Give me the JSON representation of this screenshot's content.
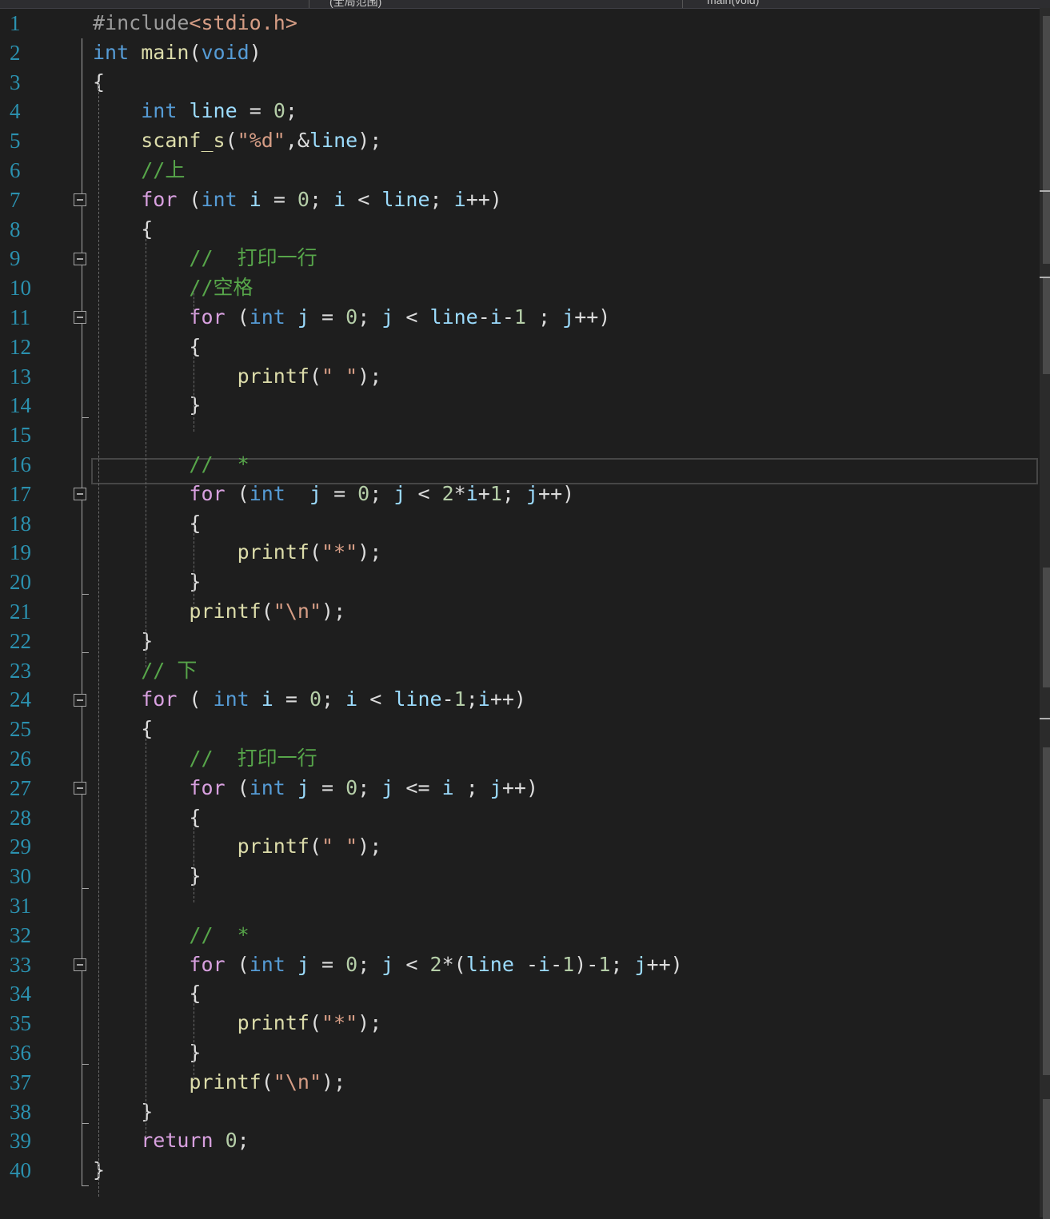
{
  "navbar": {
    "left_scope": "(全局范围)",
    "right_scope": "main(void)"
  },
  "editor": {
    "lines": [
      {
        "n": "1",
        "tokens": [
          [
            "pp",
            "#include"
          ],
          [
            "inc",
            "<stdio.h>"
          ]
        ]
      },
      {
        "n": "2",
        "tokens": [
          [
            "kw",
            "int"
          ],
          [
            "",
            " "
          ],
          [
            "fn",
            "main"
          ],
          [
            "",
            "("
          ],
          [
            "kw",
            "void"
          ],
          [
            "",
            ")"
          ]
        ]
      },
      {
        "n": "3",
        "tokens": [
          [
            "",
            "{"
          ]
        ]
      },
      {
        "n": "4",
        "tokens": [
          [
            "",
            "    "
          ],
          [
            "kw",
            "int"
          ],
          [
            "",
            " "
          ],
          [
            "var",
            "line"
          ],
          [
            "",
            " = "
          ],
          [
            "num",
            "0"
          ],
          [
            "",
            ";"
          ]
        ]
      },
      {
        "n": "5",
        "tokens": [
          [
            "",
            "    "
          ],
          [
            "fn",
            "scanf_s"
          ],
          [
            "",
            "("
          ],
          [
            "str",
            "\"%d\""
          ],
          [
            "",
            ",&"
          ],
          [
            "var",
            "line"
          ],
          [
            "",
            ");"
          ]
        ]
      },
      {
        "n": "6",
        "tokens": [
          [
            "",
            "    "
          ],
          [
            "cmt",
            "//上"
          ]
        ]
      },
      {
        "n": "7",
        "tokens": [
          [
            "",
            "    "
          ],
          [
            "ctl",
            "for"
          ],
          [
            "",
            " ("
          ],
          [
            "kw",
            "int"
          ],
          [
            "",
            " "
          ],
          [
            "var",
            "i"
          ],
          [
            "",
            " = "
          ],
          [
            "num",
            "0"
          ],
          [
            "",
            "; "
          ],
          [
            "var",
            "i"
          ],
          [
            "",
            " < "
          ],
          [
            "var",
            "line"
          ],
          [
            "",
            "; "
          ],
          [
            "var",
            "i"
          ],
          [
            "",
            "++)"
          ]
        ]
      },
      {
        "n": "8",
        "tokens": [
          [
            "",
            "    {"
          ]
        ]
      },
      {
        "n": "9",
        "tokens": [
          [
            "",
            "        "
          ],
          [
            "cmt",
            "//  打印一行"
          ]
        ]
      },
      {
        "n": "10",
        "tokens": [
          [
            "",
            "        "
          ],
          [
            "cmt",
            "//空格"
          ]
        ]
      },
      {
        "n": "11",
        "tokens": [
          [
            "",
            "        "
          ],
          [
            "ctl",
            "for"
          ],
          [
            "",
            " ("
          ],
          [
            "kw",
            "int"
          ],
          [
            "",
            " "
          ],
          [
            "var",
            "j"
          ],
          [
            "",
            " = "
          ],
          [
            "num",
            "0"
          ],
          [
            "",
            "; "
          ],
          [
            "var",
            "j"
          ],
          [
            "",
            " < "
          ],
          [
            "var",
            "line"
          ],
          [
            "",
            "-"
          ],
          [
            "var",
            "i"
          ],
          [
            "",
            "-"
          ],
          [
            "num",
            "1"
          ],
          [
            "",
            " ; "
          ],
          [
            "var",
            "j"
          ],
          [
            "",
            "++)"
          ]
        ]
      },
      {
        "n": "12",
        "tokens": [
          [
            "",
            "        {"
          ]
        ]
      },
      {
        "n": "13",
        "tokens": [
          [
            "",
            "            "
          ],
          [
            "fn",
            "printf"
          ],
          [
            "",
            "("
          ],
          [
            "str",
            "\" \""
          ],
          [
            "",
            ");"
          ]
        ]
      },
      {
        "n": "14",
        "tokens": [
          [
            "",
            "        }"
          ]
        ]
      },
      {
        "n": "15",
        "tokens": []
      },
      {
        "n": "16",
        "tokens": [
          [
            "",
            "        "
          ],
          [
            "cmt",
            "//  *"
          ]
        ]
      },
      {
        "n": "17",
        "tokens": [
          [
            "",
            "        "
          ],
          [
            "ctl",
            "for"
          ],
          [
            "",
            " ("
          ],
          [
            "kw",
            "int"
          ],
          [
            "",
            "  "
          ],
          [
            "var",
            "j"
          ],
          [
            "",
            " = "
          ],
          [
            "num",
            "0"
          ],
          [
            "",
            "; "
          ],
          [
            "var",
            "j"
          ],
          [
            "",
            " < "
          ],
          [
            "num",
            "2"
          ],
          [
            "",
            "*"
          ],
          [
            "var",
            "i"
          ],
          [
            "",
            "+"
          ],
          [
            "num",
            "1"
          ],
          [
            "",
            "; "
          ],
          [
            "var",
            "j"
          ],
          [
            "",
            "++)"
          ]
        ]
      },
      {
        "n": "18",
        "tokens": [
          [
            "",
            "        {"
          ]
        ]
      },
      {
        "n": "19",
        "tokens": [
          [
            "",
            "            "
          ],
          [
            "fn",
            "printf"
          ],
          [
            "",
            "("
          ],
          [
            "str",
            "\"*\""
          ],
          [
            "",
            ");"
          ]
        ]
      },
      {
        "n": "20",
        "tokens": [
          [
            "",
            "        }"
          ]
        ]
      },
      {
        "n": "21",
        "tokens": [
          [
            "",
            "        "
          ],
          [
            "fn",
            "printf"
          ],
          [
            "",
            "("
          ],
          [
            "str",
            "\"\\n\""
          ],
          [
            "",
            ");"
          ]
        ]
      },
      {
        "n": "22",
        "tokens": [
          [
            "",
            "    }"
          ]
        ]
      },
      {
        "n": "23",
        "tokens": [
          [
            "",
            "    "
          ],
          [
            "cmt",
            "// 下"
          ]
        ]
      },
      {
        "n": "24",
        "tokens": [
          [
            "",
            "    "
          ],
          [
            "ctl",
            "for"
          ],
          [
            "",
            " ( "
          ],
          [
            "kw",
            "int"
          ],
          [
            "",
            " "
          ],
          [
            "var",
            "i"
          ],
          [
            "",
            " = "
          ],
          [
            "num",
            "0"
          ],
          [
            "",
            "; "
          ],
          [
            "var",
            "i"
          ],
          [
            "",
            " < "
          ],
          [
            "var",
            "line"
          ],
          [
            "",
            "-"
          ],
          [
            "num",
            "1"
          ],
          [
            "",
            ";"
          ],
          [
            "var",
            "i"
          ],
          [
            "",
            "++)"
          ]
        ]
      },
      {
        "n": "25",
        "tokens": [
          [
            "",
            "    {"
          ]
        ]
      },
      {
        "n": "26",
        "tokens": [
          [
            "",
            "        "
          ],
          [
            "cmt",
            "//  打印一行"
          ]
        ]
      },
      {
        "n": "27",
        "tokens": [
          [
            "",
            "        "
          ],
          [
            "ctl",
            "for"
          ],
          [
            "",
            " ("
          ],
          [
            "kw",
            "int"
          ],
          [
            "",
            " "
          ],
          [
            "var",
            "j"
          ],
          [
            "",
            " = "
          ],
          [
            "num",
            "0"
          ],
          [
            "",
            "; "
          ],
          [
            "var",
            "j"
          ],
          [
            "",
            " <= "
          ],
          [
            "var",
            "i"
          ],
          [
            "",
            " ; "
          ],
          [
            "var",
            "j"
          ],
          [
            "",
            "++)"
          ]
        ]
      },
      {
        "n": "28",
        "tokens": [
          [
            "",
            "        {"
          ]
        ]
      },
      {
        "n": "29",
        "tokens": [
          [
            "",
            "            "
          ],
          [
            "fn",
            "printf"
          ],
          [
            "",
            "("
          ],
          [
            "str",
            "\" \""
          ],
          [
            "",
            ");"
          ]
        ]
      },
      {
        "n": "30",
        "tokens": [
          [
            "",
            "        }"
          ]
        ]
      },
      {
        "n": "31",
        "tokens": []
      },
      {
        "n": "32",
        "tokens": [
          [
            "",
            "        "
          ],
          [
            "cmt",
            "//  *"
          ]
        ]
      },
      {
        "n": "33",
        "tokens": [
          [
            "",
            "        "
          ],
          [
            "ctl",
            "for"
          ],
          [
            "",
            " ("
          ],
          [
            "kw",
            "int"
          ],
          [
            "",
            " "
          ],
          [
            "var",
            "j"
          ],
          [
            "",
            " = "
          ],
          [
            "num",
            "0"
          ],
          [
            "",
            "; "
          ],
          [
            "var",
            "j"
          ],
          [
            "",
            " < "
          ],
          [
            "num",
            "2"
          ],
          [
            "",
            "*("
          ],
          [
            "var",
            "line"
          ],
          [
            "",
            " -"
          ],
          [
            "var",
            "i"
          ],
          [
            "",
            "-"
          ],
          [
            "num",
            "1"
          ],
          [
            "",
            ")-"
          ],
          [
            "num",
            "1"
          ],
          [
            "",
            "; "
          ],
          [
            "var",
            "j"
          ],
          [
            "",
            "++)"
          ]
        ]
      },
      {
        "n": "34",
        "tokens": [
          [
            "",
            "        {"
          ]
        ]
      },
      {
        "n": "35",
        "tokens": [
          [
            "",
            "            "
          ],
          [
            "fn",
            "printf"
          ],
          [
            "",
            "("
          ],
          [
            "str",
            "\"*\""
          ],
          [
            "",
            ");"
          ]
        ]
      },
      {
        "n": "36",
        "tokens": [
          [
            "",
            "        }"
          ]
        ]
      },
      {
        "n": "37",
        "tokens": [
          [
            "",
            "        "
          ],
          [
            "fn",
            "printf"
          ],
          [
            "",
            "("
          ],
          [
            "str",
            "\"\\n\""
          ],
          [
            "",
            ");"
          ]
        ]
      },
      {
        "n": "38",
        "tokens": [
          [
            "",
            "    }"
          ]
        ]
      },
      {
        "n": "39",
        "tokens": [
          [
            "",
            "    "
          ],
          [
            "ctl",
            "return"
          ],
          [
            "",
            " "
          ],
          [
            "num",
            "0"
          ],
          [
            "",
            ";"
          ]
        ]
      },
      {
        "n": "40",
        "tokens": [
          [
            "",
            "}"
          ]
        ]
      }
    ],
    "folds": [
      {
        "start": 7,
        "end": 22
      },
      {
        "start": 9,
        "end": 14
      },
      {
        "start": 11,
        "end": 14
      },
      {
        "start": 17,
        "end": 20
      },
      {
        "start": 24,
        "end": 38
      },
      {
        "start": 27,
        "end": 30
      },
      {
        "start": 33,
        "end": 36
      }
    ],
    "current_line": 16
  }
}
